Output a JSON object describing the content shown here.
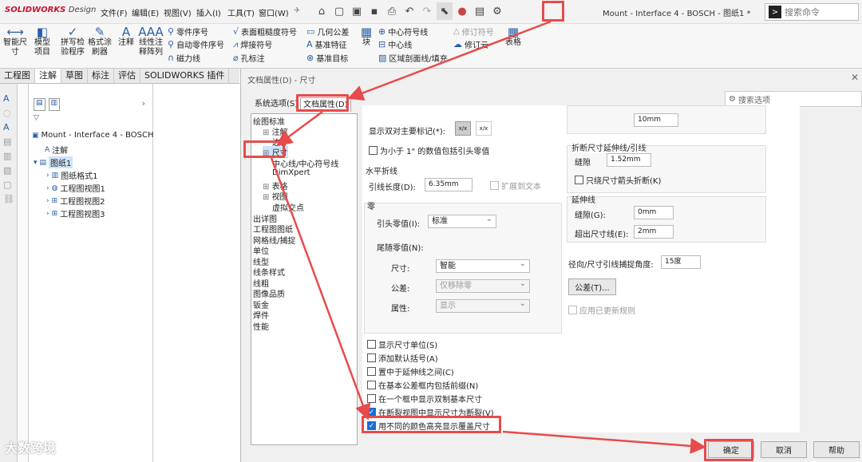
{
  "app": {
    "logo": "SOLIDWORKS",
    "logo_sub": "Design",
    "document_title": "Mount - Interface 4 - BOSCH - 图纸1 *",
    "search_placeholder": "搜索命令"
  },
  "menu": [
    "文件(F)",
    "编辑(E)",
    "视图(V)",
    "插入(I)",
    "工具(T)",
    "窗口(W)"
  ],
  "ribbon": {
    "smart_dim": "智能尺寸",
    "model_items": "模型项目",
    "spell": "拼写检验程序",
    "format_painter": "格式涂刷器",
    "note": "注释",
    "linear_note": "线性注释阵列",
    "balloon": "零件序号",
    "auto_balloon": "自动零件序号",
    "magnetic": "磁力线",
    "surface": "表面粗糙度符号",
    "weld": "焊接符号",
    "hole": "孔标注",
    "gtol": "几何公差",
    "datum_feature": "基准特征",
    "datum_target": "基准目标",
    "block": "块",
    "center_mark": "中心符号线",
    "centerline": "中心线",
    "hatch": "区域剖面线/填充",
    "rev_symbol": "修订符号",
    "rev_cloud": "修订云",
    "table": "表格"
  },
  "tabs": [
    "工程图",
    "注解",
    "草图",
    "标注",
    "评估",
    "SOLIDWORKS 插件"
  ],
  "tree": {
    "root": "Mount - Interface 4 - BOSCH",
    "annotation": "注解",
    "sheet": "图纸1",
    "sheet_format": "图纸格式1",
    "views": [
      "工程图视图1",
      "工程图视图2",
      "工程图视图3"
    ]
  },
  "dialog": {
    "title": "文档属性(D) - 尺寸",
    "tab_system": "系统选项(S)",
    "tab_document": "文档属性(D)",
    "search": "搜索选项",
    "categories": [
      "绘图标准",
      "注解",
      "边界",
      "尺寸",
      "中心线/中心符号线",
      "DimXpert",
      "表格",
      "视图",
      "虚拟交点",
      "出详图",
      "工程图图纸",
      "网格线/捕捉",
      "单位",
      "线型",
      "线条样式",
      "线粗",
      "图像品质",
      "钣金",
      "焊件",
      "性能"
    ],
    "dual_display": "显示双对主要标记(*):",
    "include_leading_zero": "为小于 1\" 的数值包括引头零值",
    "horizontal_break": "水平折线",
    "leader_length": "引线长度(D):",
    "leader_length_val": "6.35mm",
    "extend_to_text": "扩展到文本",
    "zeros": "零",
    "leading_zeros": "引头零值(I):",
    "leading_zeros_val": "标准",
    "trailing_zeros": "尾随零值(N):",
    "dimensions": "尺寸:",
    "dimensions_val": "智能",
    "tolerance": "公差:",
    "tolerance_val": "仅移除零",
    "properties": "属性:",
    "properties_val": "显示",
    "top_val": "10mm",
    "break_ext": "折断尺寸延伸线/引线",
    "gap": "缝隙",
    "gap_val": "1.52mm",
    "break_only_arrow": "只绕尺寸箭头折断(K)",
    "ext_lines": "延伸线",
    "ext_gap": "缝隙(G):",
    "ext_gap_val": "0mm",
    "ext_beyond": "超出尺寸线(E):",
    "ext_beyond_val": "2mm",
    "radial_snap": "径向/尺寸引线捕捉角度:",
    "radial_snap_val": "15度",
    "tolerance_btn": "公差(T)...",
    "apply_updated": "应用已更新规则",
    "checks": [
      "显示尺寸单位(S)",
      "添加默认括号(A)",
      "置中于延伸线之间(C)",
      "在基本公差框内包括前缀(N)",
      "在一个框中显示双制基本尺寸",
      "在断裂视图中显示尺寸为断裂(V)",
      "用不同的颜色高亮显示覆盖尺寸"
    ],
    "ok": "确定",
    "cancel": "取消",
    "help": "帮助"
  },
  "watermark": "大数跨境",
  "colors": {
    "highlight": "#e84b4b",
    "accent": "#1a6ed6"
  }
}
